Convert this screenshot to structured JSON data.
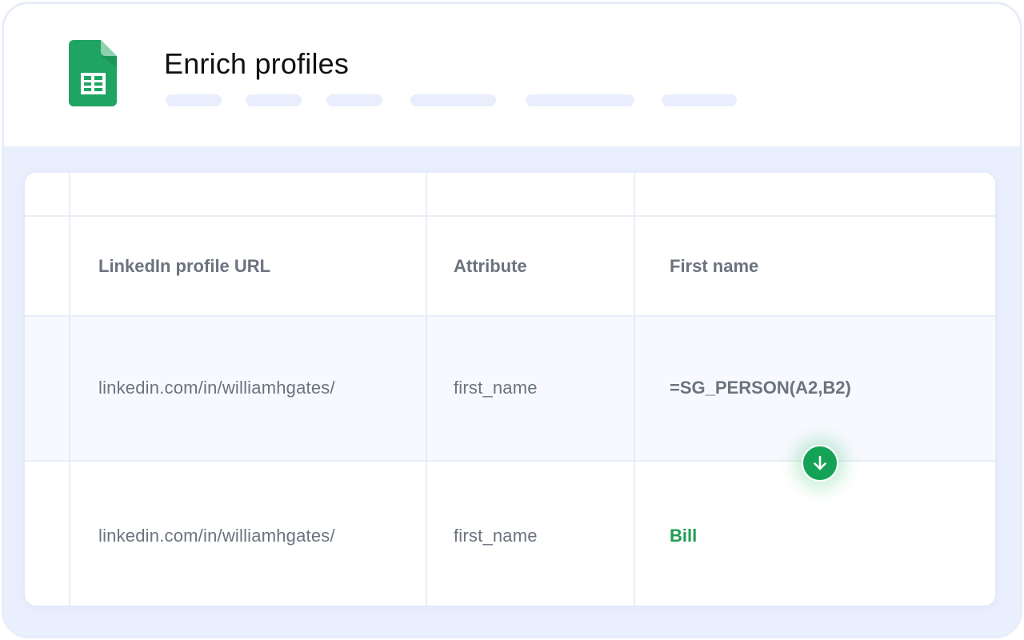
{
  "header": {
    "title": "Enrich profiles",
    "app_icon": "google-sheets-icon"
  },
  "table": {
    "columns": [
      "LinkedIn profile URL",
      "Attribute",
      "First name"
    ],
    "rows": [
      {
        "url": "linkedin.com/in/williamhgates/",
        "attribute": "first_name",
        "value": "=SG_PERSON(A2,B2)"
      },
      {
        "url": "linkedin.com/in/williamhgates/",
        "attribute": "first_name",
        "value": "Bill"
      }
    ]
  },
  "fill_down_icon": "arrow-down-icon",
  "colors": {
    "background": "#e9effd",
    "result_green": "#1e9e52",
    "button_green": "#14a356",
    "sheets_green": "#1fa463",
    "text_gray": "#6b737f"
  }
}
